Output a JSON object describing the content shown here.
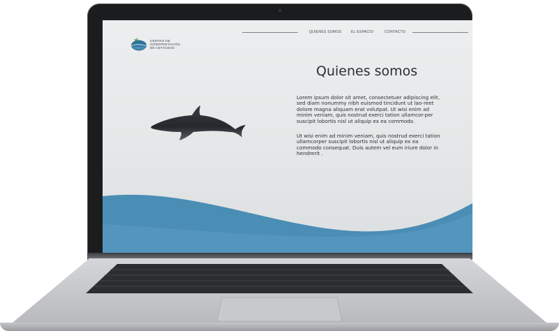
{
  "site": {
    "logo_lines": [
      "CENTRO DE",
      "INTERPRETACIÓN",
      "DE CETÁCEOS"
    ],
    "nav": [
      "QUIENES SOMOS",
      "EL ESPACIO",
      "CONTACTO"
    ],
    "title": "Quienes somos",
    "paragraphs": [
      "Lorem ipsum dolor sit amet, consectetuer adipiscing elit, sed diam nonummy nibh euismod tincidunt ut lao-reet dolore magna aliquam erat volutpat. Ut wisi enim ad minim veniam, quis nostrud exerci tation ullamcor-per suscipit lobortis nisl ut aliquip ex ea commodo.",
      "Ut wisi enim ad minim veniam, quis nostrud exerci tation ullamcorper suscipit lobortis nisl ut aliquip ex ea commodo consequat. Duis autem vel eum iriure dolor in hendrerit ."
    ]
  },
  "colors": {
    "wave_blue": "#4a8db5",
    "wave_light": "#6aa9cc",
    "text": "#2c2f33",
    "laptop_body": "#c9cbce"
  },
  "icons": [
    "cetacean-logo-icon",
    "dolphin-illustration"
  ]
}
